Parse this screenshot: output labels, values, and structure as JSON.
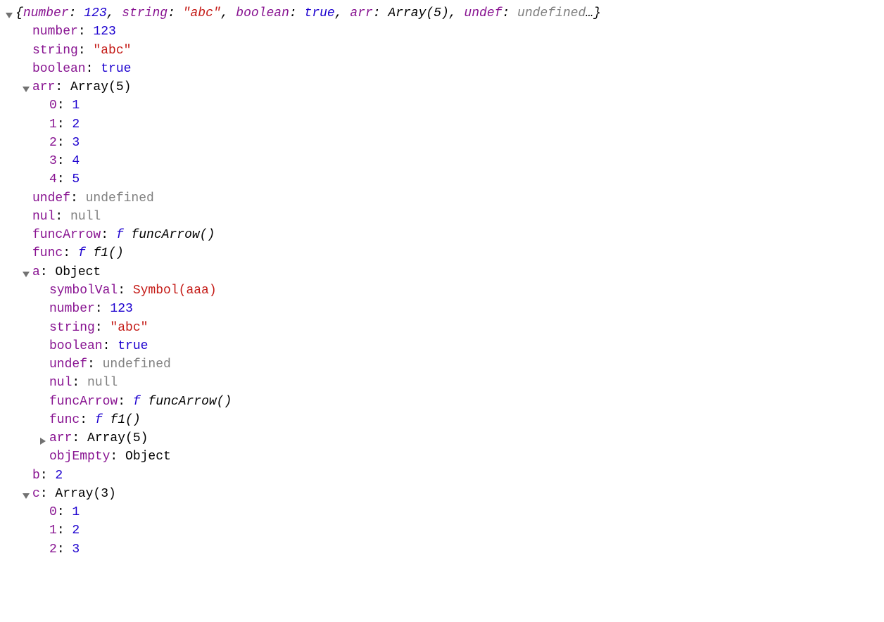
{
  "summary": {
    "items": [
      {
        "k": "number",
        "v": "123",
        "cls": "num"
      },
      {
        "k": "string",
        "v": "\"abc\"",
        "cls": "str"
      },
      {
        "k": "boolean",
        "v": "true",
        "cls": "bool"
      },
      {
        "k": "arr",
        "v": "Array(5)",
        "cls": "objlabel"
      },
      {
        "k": "undef",
        "v": "undefined",
        "cls": "undef"
      }
    ]
  },
  "p": {
    "number_k": "number",
    "number_v": "123",
    "string_k": "string",
    "string_v": "\"abc\"",
    "boolean_k": "boolean",
    "boolean_v": "true",
    "arr_k": "arr",
    "arr_v": "Array(5)",
    "arr_0_k": "0",
    "arr_0_v": "1",
    "arr_1_k": "1",
    "arr_1_v": "2",
    "arr_2_k": "2",
    "arr_2_v": "3",
    "arr_3_k": "3",
    "arr_3_v": "4",
    "arr_4_k": "4",
    "arr_4_v": "5",
    "undef_k": "undef",
    "undef_v": "undefined",
    "nul_k": "nul",
    "nul_v": "null",
    "funcArrow_k": "funcArrow",
    "funcArrow_f": "f",
    "funcArrow_n": "funcArrow()",
    "func_k": "func",
    "func_f": "f",
    "func_n": "f1()",
    "a_k": "a",
    "a_v": "Object",
    "a_symbolVal_k": "symbolVal",
    "a_symbolVal_v": "Symbol(aaa)",
    "a_number_k": "number",
    "a_number_v": "123",
    "a_string_k": "string",
    "a_string_v": "\"abc\"",
    "a_boolean_k": "boolean",
    "a_boolean_v": "true",
    "a_undef_k": "undef",
    "a_undef_v": "undefined",
    "a_nul_k": "nul",
    "a_nul_v": "null",
    "a_funcArrow_k": "funcArrow",
    "a_funcArrow_f": "f",
    "a_funcArrow_n": "funcArrow()",
    "a_func_k": "func",
    "a_func_f": "f",
    "a_func_n": "f1()",
    "a_arr_k": "arr",
    "a_arr_v": "Array(5)",
    "a_objEmpty_k": "objEmpty",
    "a_objEmpty_v": "Object",
    "b_k": "b",
    "b_v": "2",
    "c_k": "c",
    "c_v": "Array(3)",
    "c_0_k": "0",
    "c_0_v": "1",
    "c_1_k": "1",
    "c_1_v": "2",
    "c_2_k": "2",
    "c_2_v": "3"
  }
}
